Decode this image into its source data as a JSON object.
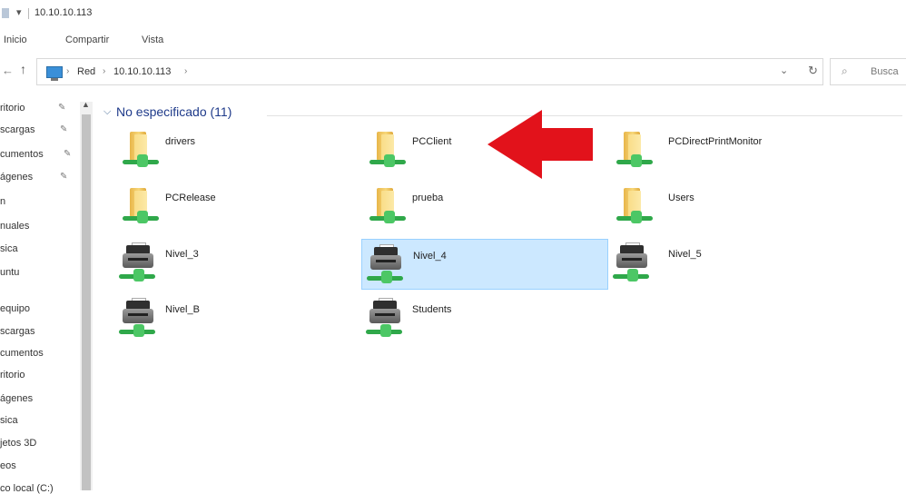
{
  "window": {
    "title": "10.10.10.113"
  },
  "ribbon": {
    "tabs": [
      "Inicio",
      "Compartir",
      "Vista"
    ]
  },
  "address": {
    "crumbs": [
      "Red",
      "10.10.10.113"
    ],
    "sep": "›"
  },
  "search": {
    "placeholder": "Busca"
  },
  "sidebar": {
    "items": [
      "ritorio",
      "scargas",
      "cumentos",
      "ágenes",
      "n",
      "nuales",
      "sica",
      "untu",
      "equipo",
      "scargas",
      "cumentos",
      "ritorio",
      "ágenes",
      "sica",
      "jetos 3D",
      "eos",
      "co local (C:)"
    ]
  },
  "group": {
    "label": "No especificado (11)"
  },
  "items": [
    {
      "label": "drivers",
      "type": "folder"
    },
    {
      "label": "PCClient",
      "type": "folder"
    },
    {
      "label": "PCDirectPrintMonitor",
      "type": "folder"
    },
    {
      "label": "PCRelease",
      "type": "folder"
    },
    {
      "label": "prueba",
      "type": "folder"
    },
    {
      "label": "Users",
      "type": "folder"
    },
    {
      "label": "Nivel_3",
      "type": "printer"
    },
    {
      "label": "Nivel_4",
      "type": "printer",
      "selected": true
    },
    {
      "label": "Nivel_5",
      "type": "printer"
    },
    {
      "label": "Nivel_B",
      "type": "printer"
    },
    {
      "label": "Students",
      "type": "printer"
    }
  ],
  "colors": {
    "selection": "#cce8ff",
    "accent_arrow": "#e2121b",
    "group_header": "#1e3a8a"
  },
  "icons": [
    "folder-icon",
    "printer-icon",
    "network-share-icon",
    "computer-icon",
    "pin-icon",
    "refresh-icon",
    "search-icon",
    "up-arrow-icon",
    "back-arrow-icon",
    "red-arrow-annotation"
  ]
}
